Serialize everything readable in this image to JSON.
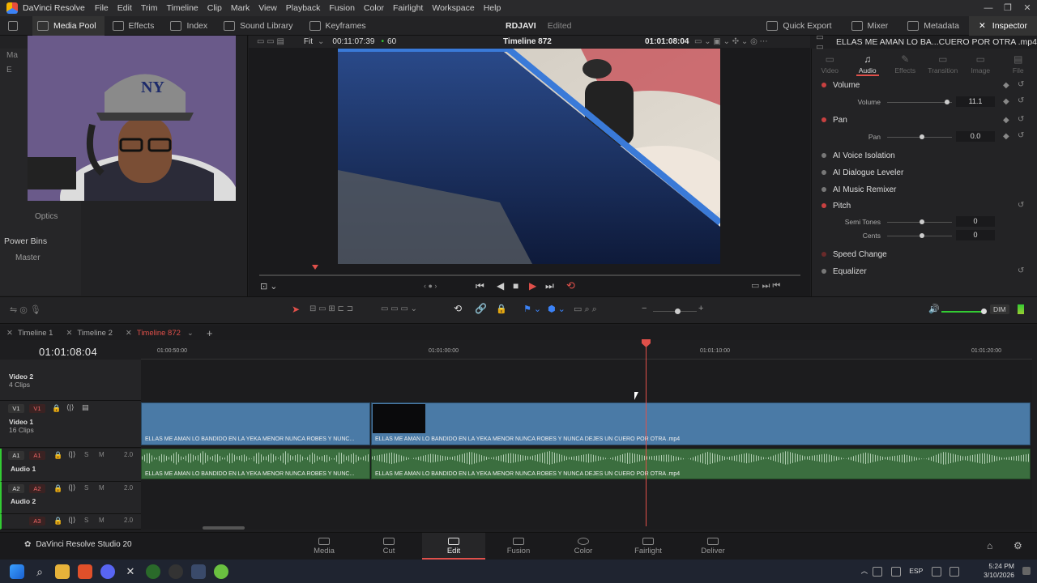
{
  "menubar": {
    "app_name": "DaVinci Resolve",
    "items": [
      "File",
      "Edit",
      "Trim",
      "Timeline",
      "Clip",
      "Mark",
      "View",
      "Playback",
      "Fusion",
      "Color",
      "Fairlight",
      "Workspace",
      "Help"
    ]
  },
  "toolbar": {
    "media_pool": "Media Pool",
    "effects": "Effects",
    "index": "Index",
    "sound_library": "Sound Library",
    "keyframes": "Keyframes",
    "project_name": "RDJAVI",
    "project_status": "Edited",
    "quick_export": "Quick Export",
    "mixer": "Mixer",
    "metadata": "Metadata",
    "inspector": "Inspector"
  },
  "left_panel": {
    "tree_rows": [
      "Ma",
      "E",
      "",
      "",
      "",
      ""
    ],
    "optics": "Optics",
    "power_bins": "Power Bins",
    "master": "Master"
  },
  "viewer": {
    "fit": "Fit",
    "source_tc": "00:11:07:39",
    "fps": "60",
    "timeline_name": "Timeline 872",
    "record_tc": "01:01:08:04"
  },
  "inspector": {
    "clip_name": "ELLAS ME AMAN LO BA...CUERO POR OTRA .mp4",
    "tabs": [
      "Video",
      "Audio",
      "Effects",
      "Transition",
      "Image",
      "File"
    ],
    "volume_title": "Volume",
    "volume_label": "Volume",
    "volume_value": "11.1",
    "pan_title": "Pan",
    "pan_label": "Pan",
    "pan_value": "0.0",
    "ai_voice": "AI Voice Isolation",
    "ai_dialogue": "AI Dialogue Leveler",
    "ai_music": "AI Music Remixer",
    "pitch_title": "Pitch",
    "semitones_label": "Semi Tones",
    "semitones_value": "0",
    "cents_label": "Cents",
    "cents_value": "0",
    "speed_change": "Speed Change",
    "equalizer": "Equalizer"
  },
  "edit_tools": {
    "dim": "DIM"
  },
  "timeline_tabs": [
    "Timeline 1",
    "Timeline 2",
    "Timeline 872"
  ],
  "timecode": "01:01:08:04",
  "ruler_labels": [
    "01:00:50:00",
    "01:01:00:00",
    "01:01:10:00",
    "01:01:20:00"
  ],
  "tracks": {
    "v2": {
      "tag": "V2",
      "name": "Video 2",
      "count": "4 Clips"
    },
    "v1": {
      "tag": "V1",
      "name": "Video 1",
      "count": "16 Clips"
    },
    "a1": {
      "tag": "A1",
      "name": "Audio 1",
      "level": "2.0"
    },
    "a2": {
      "tag": "A2",
      "name": "Audio 2",
      "level": "2.0"
    },
    "a3": {
      "tag": "A3",
      "level": "2.0"
    }
  },
  "clips": {
    "v_clip1": "ELLAS ME AMAN LO BANDIDO EN LA YEKA MENOR NUNCA ROBES Y NUNC...",
    "v_clip2": "ELLAS ME AMAN LO BANDIDO EN LA YEKA MENOR NUNCA ROBES Y NUNCA DEJES UN CUERO POR OTRA .mp4",
    "a_clip1": "ELLAS ME AMAN LO BANDIDO EN LA YEKA MENOR NUNCA ROBES Y NUNC...",
    "a_clip2": "ELLAS ME AMAN LO BANDIDO EN LA YEKA MENOR NUNCA ROBES Y NUNCA DEJES UN CUERO POR OTRA .mp4"
  },
  "pages": [
    "Media",
    "Cut",
    "Edit",
    "Fusion",
    "Color",
    "Fairlight",
    "Deliver"
  ],
  "brand": "DaVinci Resolve Studio 20",
  "taskbar": {
    "lang": "ESP",
    "time": "5:24 PM",
    "date": "3/10/2026"
  }
}
